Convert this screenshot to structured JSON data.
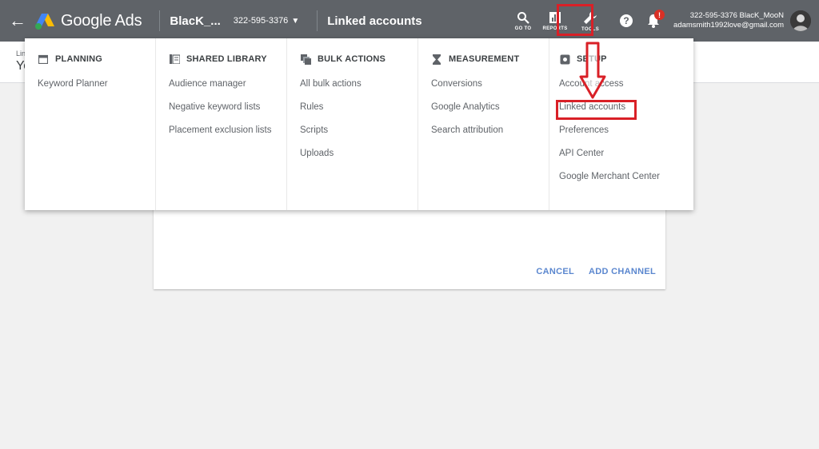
{
  "topbar": {
    "brand": "Google Ads",
    "account_name": "BlacK_...",
    "account_id": "322-595-3376",
    "page_title": "Linked accounts",
    "goto_label": "GO TO",
    "reports_label": "REPORTS",
    "tools_label": "TOOLS",
    "notification_badge": "!",
    "user_line1": "322-595-3376 BlacK_MooN",
    "user_line2": "adamsmith1992love@gmail.com"
  },
  "background": {
    "breadcrumb": "Lin",
    "heading": "Yo",
    "cancel_label": "CANCEL",
    "add_channel_label": "ADD CHANNEL"
  },
  "menu": {
    "columns": [
      {
        "title": "PLANNING",
        "icon": "calendar-icon",
        "items": [
          "Keyword Planner"
        ]
      },
      {
        "title": "SHARED LIBRARY",
        "icon": "library-icon",
        "items": [
          "Audience manager",
          "Negative keyword lists",
          "Placement exclusion lists"
        ]
      },
      {
        "title": "BULK ACTIONS",
        "icon": "bulk-icon",
        "items": [
          "All bulk actions",
          "Rules",
          "Scripts",
          "Uploads"
        ]
      },
      {
        "title": "MEASUREMENT",
        "icon": "hourglass-icon",
        "items": [
          "Conversions",
          "Google Analytics",
          "Search attribution"
        ]
      },
      {
        "title": "SETUP",
        "icon": "gear-icon",
        "items": [
          "Account access",
          "Linked accounts",
          "Preferences",
          "API Center",
          "Google Merchant Center"
        ]
      }
    ]
  },
  "colors": {
    "topbar": "#5f6368",
    "highlight": "#d92027",
    "link_blue": "#5b87cf",
    "badge_red": "#d93025"
  }
}
